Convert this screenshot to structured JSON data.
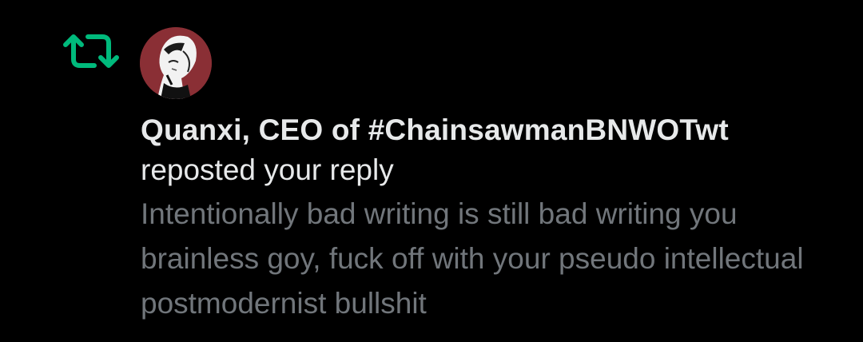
{
  "notification": {
    "type_icon": "repost-icon",
    "type_icon_color": "#00ba7c",
    "avatar": {
      "icon": "anime-avatar",
      "background_color": "#8a2f35"
    },
    "actor_name": "Quanxi, CEO of #ChainsawmanBNWOTwt",
    "action": "reposted your reply",
    "reply_text": "Intentionally bad writing is still bad writing you brainless goy, fuck off with your pseudo intellectual postmodernist bullshit"
  },
  "colors": {
    "background": "#000000",
    "primary_text": "#e7e9ea",
    "secondary_text": "#71767b",
    "repost_green": "#00ba7c"
  }
}
